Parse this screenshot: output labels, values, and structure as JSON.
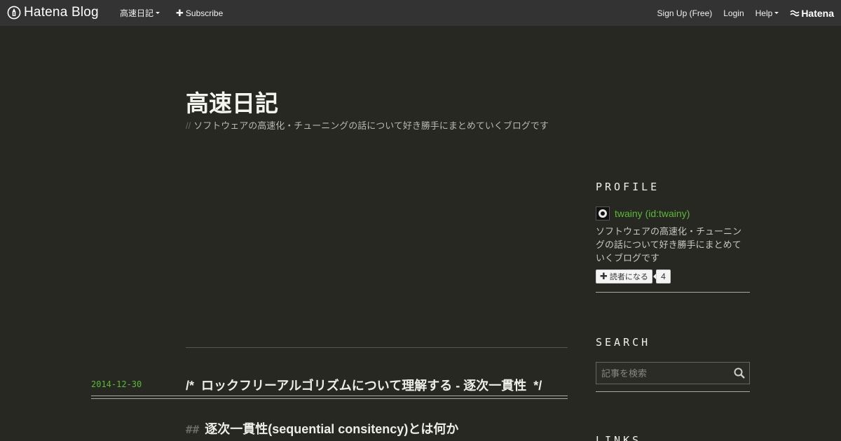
{
  "topbar": {
    "brand": "Hatena Blog",
    "blog_menu": "高速日記",
    "subscribe": "Subscribe",
    "signup": "Sign Up (Free)",
    "login": "Login",
    "help": "Help",
    "hatena": "Hatena"
  },
  "blog": {
    "title": "高速日記",
    "desc_prefix": "//",
    "description": "ソフトウェアの高速化・チューニングの話について好き勝手にまとめていくブログです"
  },
  "entry": {
    "date": "2014-12-30",
    "title": "/*  ロックフリーアルゴリズムについて理解する - 逐次一貫性  */",
    "section_hash": "##",
    "section_title": "逐次一貫性(sequential consitency)とは何か"
  },
  "sidebar": {
    "profile_heading": "PROFILE",
    "profile_name": "twainy (id:twainy)",
    "profile_desc": "ソフトウェアの高速化・チューニングの話について好き勝手にまとめていくブログです",
    "reader_button": "読者になる",
    "reader_count": "4",
    "search_heading": "SEARCH",
    "search_placeholder": "記事を検索",
    "links_heading": "LINKS"
  },
  "colors": {
    "background": "#272822",
    "topbar": "#333333",
    "accent_green": "#5cb83a"
  }
}
